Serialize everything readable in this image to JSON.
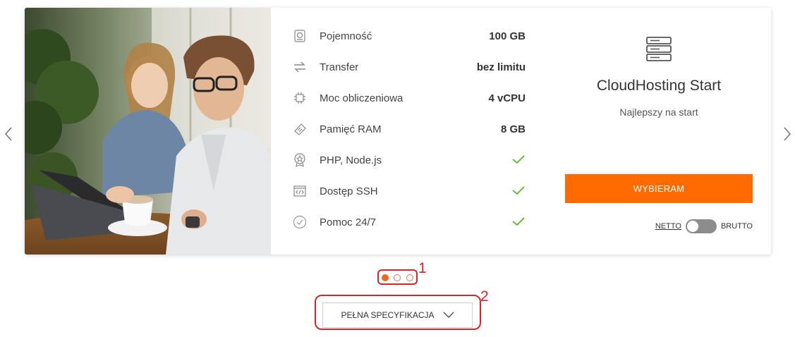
{
  "nav": {
    "prev_icon": "chevron-left-icon",
    "next_icon": "chevron-right-icon"
  },
  "specs": [
    {
      "icon": "hard-drive-icon",
      "label": "Pojemność",
      "value": "100 GB"
    },
    {
      "icon": "transfer-arrows-icon",
      "label": "Transfer",
      "value": "bez limitu"
    },
    {
      "icon": "cpu-chip-icon",
      "label": "Moc obliczeniowa",
      "value": "4 vCPU"
    },
    {
      "icon": "ram-memory-icon",
      "label": "Pamięć RAM",
      "value": "8 GB"
    },
    {
      "icon": "badge-icon",
      "label": "PHP, Node.js",
      "value": "check"
    },
    {
      "icon": "code-window-icon",
      "label": "Dostęp SSH",
      "value": "check"
    },
    {
      "icon": "check-circle-icon",
      "label": "Pomoc 24/7",
      "value": "check"
    }
  ],
  "plan": {
    "icon": "server-icon",
    "title": "CloudHosting Start",
    "subtitle": "Najlepszy na start",
    "cta_label": "WYBIERAM",
    "price_mode_left": "NETTO",
    "price_mode_right": "BRUTTO"
  },
  "carousel": {
    "active_index": 0,
    "dot_count": 3,
    "annotation_1": "1"
  },
  "more": {
    "label": "PEŁNA SPECYFIKACJA",
    "annotation_2": "2"
  },
  "colors": {
    "accent": "#ff6b00",
    "check": "#6bbf3a",
    "annotation": "#d8262b"
  }
}
